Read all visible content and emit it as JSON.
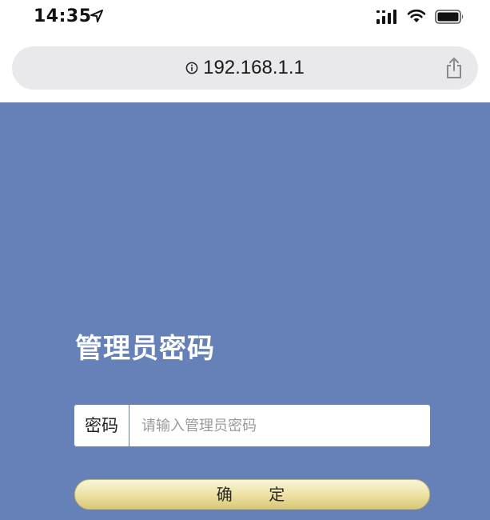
{
  "status_bar": {
    "time": "14:35",
    "location_icon": "location-arrow-icon",
    "signal_icon": "cellular-signal-icon",
    "wifi_icon": "wifi-icon",
    "battery_icon": "battery-icon"
  },
  "browser": {
    "url": "192.168.1.1",
    "info_icon": "info-circle-icon",
    "share_icon": "share-icon"
  },
  "page": {
    "background_color": "#6581b8",
    "title": "管理员密码",
    "password_label": "密码",
    "password_placeholder": "请输入管理员密码",
    "password_value": "",
    "confirm_label": "确    定"
  }
}
